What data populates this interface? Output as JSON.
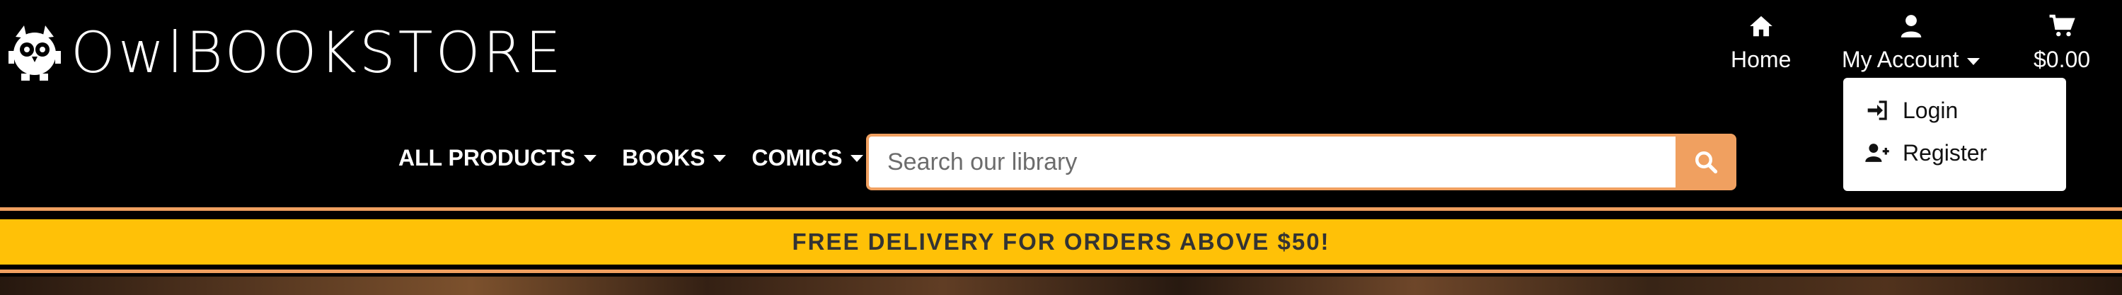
{
  "brand": {
    "name_light": "Owl",
    "name_bold": "BOOKSTORE"
  },
  "top_nav": {
    "home": "Home",
    "account": "My Account",
    "cart": "$0.00"
  },
  "account_menu": {
    "items": [
      "Login",
      "Register"
    ]
  },
  "categories": [
    "ALL PRODUCTS",
    "BOOKS",
    "COMICS"
  ],
  "search": {
    "placeholder": "Search our library"
  },
  "banner": {
    "text": "FREE DELIVERY FOR ORDERS ABOVE $50!"
  },
  "colors": {
    "accent": "#f0a060",
    "banner": "#ffc107",
    "background": "#000000"
  }
}
